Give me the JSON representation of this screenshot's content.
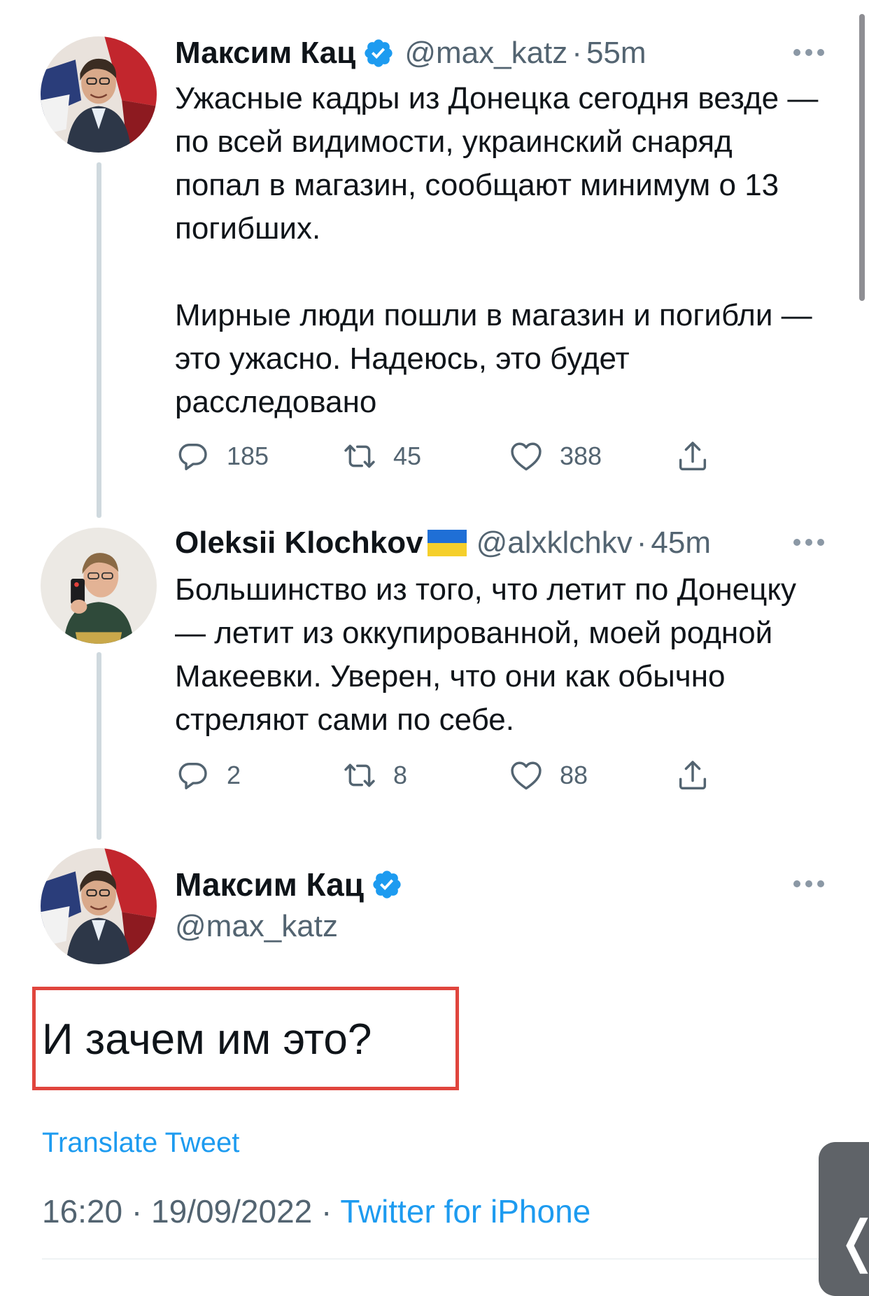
{
  "thread": [
    {
      "name": "Максим Кац",
      "verified": true,
      "handle": "@max_katz",
      "separator": "·",
      "time": "55m",
      "text": [
        "Ужасные кадры из Донецка сегодня везде — по всей видимости, украинский снаряд попал в магазин, сообщают минимум о 13 погибших.",
        "Мирные люди пошли в магазин и погибли — это ужасно. Надеюсь, это будет расследовано"
      ],
      "replies": "185",
      "retweets": "45",
      "likes": "388"
    },
    {
      "name": "Oleksii Klochkov",
      "flag": "ukraine-flag",
      "handle": "@alxklchkv",
      "separator": "·",
      "time": "45m",
      "text": [
        "Большинство из того, что летит по Донецку — летит из оккупированной, моей родной Макеевки. Уверен, что они как обычно стреляют сами по себе."
      ],
      "replies": "2",
      "retweets": "8",
      "likes": "88"
    }
  ],
  "main_tweet": {
    "name": "Максим Кац",
    "verified": true,
    "handle": "@max_katz",
    "text": "И зачем им это?",
    "translate_label": "Translate Tweet",
    "time": "16:20",
    "date": "19/09/2022",
    "separator": "·",
    "source": "Twitter for iPhone"
  },
  "icons": {
    "reply": "reply-icon",
    "retweet": "retweet-icon",
    "like": "heart-icon",
    "share": "share-icon",
    "more": "more-icon",
    "verified": "verified-badge-icon",
    "back": "chevron-left-icon"
  },
  "colors": {
    "link": "#1d9bf0",
    "secondary_text": "#536471",
    "highlight_border": "#e0453d",
    "thread_line": "#cfd9de"
  }
}
